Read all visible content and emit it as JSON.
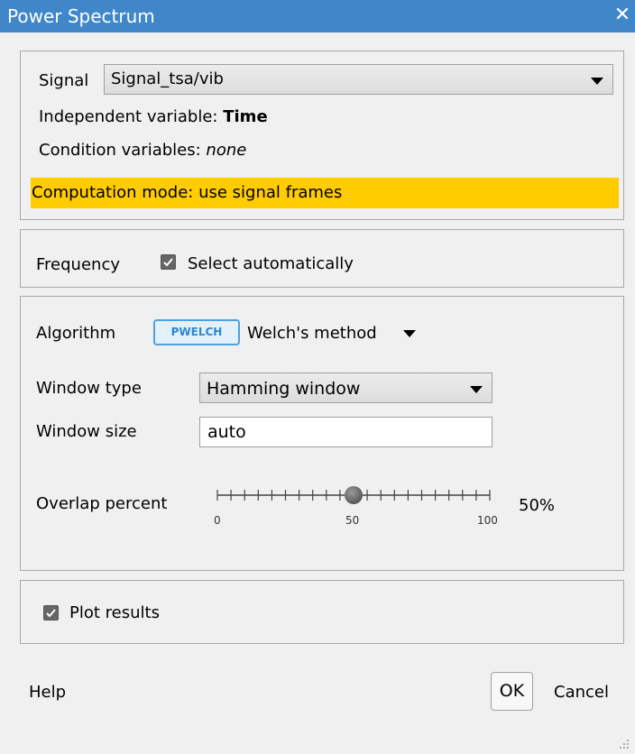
{
  "window": {
    "title": "Power Spectrum",
    "close_glyph": "✕"
  },
  "signal": {
    "label": "Signal",
    "selected": "Signal_tsa/vib",
    "independent_variable_label": "Independent variable:",
    "independent_variable_value": "Time",
    "condition_variables_label": "Condition variables:",
    "condition_variables_value": "none",
    "computation_mode": "Computation mode: use signal frames"
  },
  "frequency": {
    "label": "Frequency",
    "auto_label": "Select automatically",
    "auto_checked": true
  },
  "algorithm": {
    "label": "Algorithm",
    "badge": "PWELCH",
    "method": "Welch's method",
    "window_type_label": "Window type",
    "window_type_selected": "Hamming window",
    "window_size_label": "Window size",
    "window_size_value": "auto",
    "overlap_label": "Overlap percent",
    "overlap_value": 50,
    "overlap_display": "50%",
    "slider_min": "0",
    "slider_mid": "50",
    "slider_max": "100"
  },
  "plot": {
    "label": "Plot results",
    "checked": true
  },
  "footer": {
    "help_label": "Help",
    "ok_label": "OK",
    "cancel_label": "Cancel"
  },
  "colors": {
    "title_bar": "#3f87c8",
    "highlight": "#ffcc00",
    "badge_border": "#4aa2e3",
    "badge_text": "#2b86d3"
  }
}
